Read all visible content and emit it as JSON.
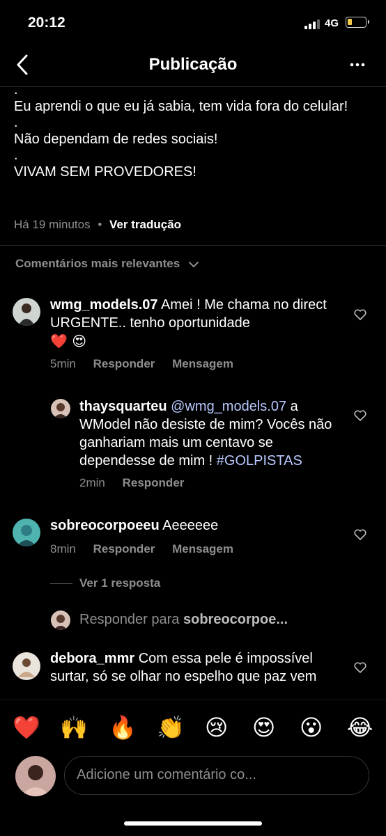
{
  "status_bar": {
    "time": "20:12",
    "network": "4G"
  },
  "nav": {
    "title": "Publicação"
  },
  "caption": {
    "lines": [
      ".",
      "Eu aprendi o que eu já sabia, tem vida fora do celular!",
      ".",
      "Não dependam de redes sociais!",
      ".",
      "VIVAM SEM PROVEDORES!"
    ],
    "time_ago": "Há 19 minutos",
    "separator": "•",
    "translate": "Ver tradução"
  },
  "comments_header": "Comentários mais relevantes",
  "comments": [
    {
      "user": "wmg_models.07",
      "text": "Amei ! Me chama no direct URGENTE.. tenho oportunidade",
      "emoji": "❤️ 😍",
      "age": "5min",
      "reply_label": "Responder",
      "message_label": "Mensagem"
    },
    {
      "user": "thaysquarteu",
      "mention": "@wmg_models.07",
      "text": "a WModel não desiste de mim? Vocês não ganhariam mais um centavo se dependesse de mim !",
      "hashtag": "#GOLPISTAS",
      "age": "2min",
      "reply_label": "Responder"
    },
    {
      "user": "sobreocorpoeeu",
      "text": "Aeeeeee",
      "age": "8min",
      "reply_label": "Responder",
      "message_label": "Mensagem"
    },
    {
      "user": "debora_mmr",
      "text": "Com essa pele é impossível surtar, só se olhar no espelho que paz vem"
    }
  ],
  "view_replies": "Ver 1 resposta",
  "reply_to": {
    "prefix": "Responder para",
    "user": "sobreocorpoe..."
  },
  "emoji_bar": [
    "❤️",
    "🙌",
    "🔥",
    "👏",
    "😢",
    "😍",
    "😮",
    "😂"
  ],
  "comment_input": {
    "placeholder": "Adicione um comentário co..."
  },
  "colors": {
    "background": "#000000",
    "secondary_text": "#8e8e8e",
    "mention": "#b8c8ff",
    "battery": "#f2c94c"
  }
}
